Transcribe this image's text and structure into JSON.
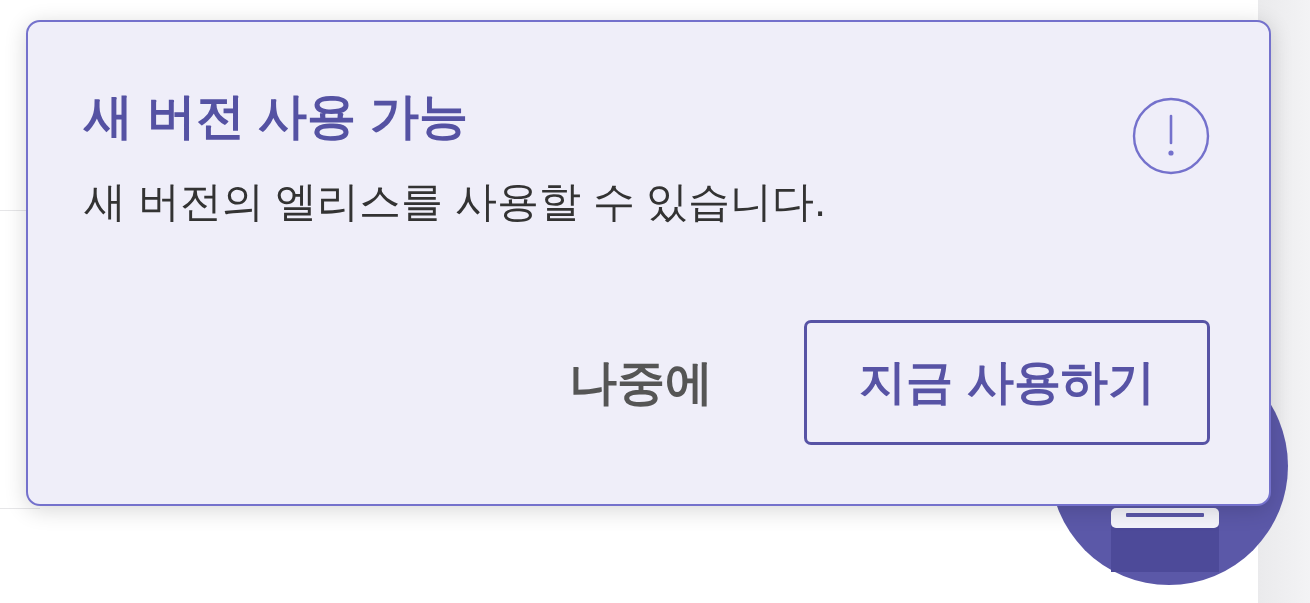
{
  "dialog": {
    "title": "새 버전 사용 가능",
    "message": "새 버전의 엘리스를 사용할 수 있습니다.",
    "buttons": [
      {
        "label": "나중에",
        "kind": "text"
      },
      {
        "label": "지금 사용하기",
        "kind": "outline"
      }
    ]
  }
}
